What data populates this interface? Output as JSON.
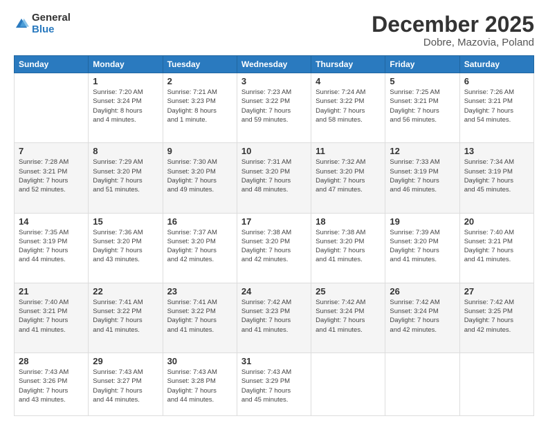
{
  "logo": {
    "general": "General",
    "blue": "Blue"
  },
  "title": "December 2025",
  "subtitle": "Dobre, Mazovia, Poland",
  "days_of_week": [
    "Sunday",
    "Monday",
    "Tuesday",
    "Wednesday",
    "Thursday",
    "Friday",
    "Saturday"
  ],
  "weeks": [
    [
      {
        "day": "",
        "info": ""
      },
      {
        "day": "1",
        "info": "Sunrise: 7:20 AM\nSunset: 3:24 PM\nDaylight: 8 hours\nand 4 minutes."
      },
      {
        "day": "2",
        "info": "Sunrise: 7:21 AM\nSunset: 3:23 PM\nDaylight: 8 hours\nand 1 minute."
      },
      {
        "day": "3",
        "info": "Sunrise: 7:23 AM\nSunset: 3:22 PM\nDaylight: 7 hours\nand 59 minutes."
      },
      {
        "day": "4",
        "info": "Sunrise: 7:24 AM\nSunset: 3:22 PM\nDaylight: 7 hours\nand 58 minutes."
      },
      {
        "day": "5",
        "info": "Sunrise: 7:25 AM\nSunset: 3:21 PM\nDaylight: 7 hours\nand 56 minutes."
      },
      {
        "day": "6",
        "info": "Sunrise: 7:26 AM\nSunset: 3:21 PM\nDaylight: 7 hours\nand 54 minutes."
      }
    ],
    [
      {
        "day": "7",
        "info": "Sunrise: 7:28 AM\nSunset: 3:21 PM\nDaylight: 7 hours\nand 52 minutes."
      },
      {
        "day": "8",
        "info": "Sunrise: 7:29 AM\nSunset: 3:20 PM\nDaylight: 7 hours\nand 51 minutes."
      },
      {
        "day": "9",
        "info": "Sunrise: 7:30 AM\nSunset: 3:20 PM\nDaylight: 7 hours\nand 49 minutes."
      },
      {
        "day": "10",
        "info": "Sunrise: 7:31 AM\nSunset: 3:20 PM\nDaylight: 7 hours\nand 48 minutes."
      },
      {
        "day": "11",
        "info": "Sunrise: 7:32 AM\nSunset: 3:20 PM\nDaylight: 7 hours\nand 47 minutes."
      },
      {
        "day": "12",
        "info": "Sunrise: 7:33 AM\nSunset: 3:19 PM\nDaylight: 7 hours\nand 46 minutes."
      },
      {
        "day": "13",
        "info": "Sunrise: 7:34 AM\nSunset: 3:19 PM\nDaylight: 7 hours\nand 45 minutes."
      }
    ],
    [
      {
        "day": "14",
        "info": "Sunrise: 7:35 AM\nSunset: 3:19 PM\nDaylight: 7 hours\nand 44 minutes."
      },
      {
        "day": "15",
        "info": "Sunrise: 7:36 AM\nSunset: 3:20 PM\nDaylight: 7 hours\nand 43 minutes."
      },
      {
        "day": "16",
        "info": "Sunrise: 7:37 AM\nSunset: 3:20 PM\nDaylight: 7 hours\nand 42 minutes."
      },
      {
        "day": "17",
        "info": "Sunrise: 7:38 AM\nSunset: 3:20 PM\nDaylight: 7 hours\nand 42 minutes."
      },
      {
        "day": "18",
        "info": "Sunrise: 7:38 AM\nSunset: 3:20 PM\nDaylight: 7 hours\nand 41 minutes."
      },
      {
        "day": "19",
        "info": "Sunrise: 7:39 AM\nSunset: 3:20 PM\nDaylight: 7 hours\nand 41 minutes."
      },
      {
        "day": "20",
        "info": "Sunrise: 7:40 AM\nSunset: 3:21 PM\nDaylight: 7 hours\nand 41 minutes."
      }
    ],
    [
      {
        "day": "21",
        "info": "Sunrise: 7:40 AM\nSunset: 3:21 PM\nDaylight: 7 hours\nand 41 minutes."
      },
      {
        "day": "22",
        "info": "Sunrise: 7:41 AM\nSunset: 3:22 PM\nDaylight: 7 hours\nand 41 minutes."
      },
      {
        "day": "23",
        "info": "Sunrise: 7:41 AM\nSunset: 3:22 PM\nDaylight: 7 hours\nand 41 minutes."
      },
      {
        "day": "24",
        "info": "Sunrise: 7:42 AM\nSunset: 3:23 PM\nDaylight: 7 hours\nand 41 minutes."
      },
      {
        "day": "25",
        "info": "Sunrise: 7:42 AM\nSunset: 3:24 PM\nDaylight: 7 hours\nand 41 minutes."
      },
      {
        "day": "26",
        "info": "Sunrise: 7:42 AM\nSunset: 3:24 PM\nDaylight: 7 hours\nand 42 minutes."
      },
      {
        "day": "27",
        "info": "Sunrise: 7:42 AM\nSunset: 3:25 PM\nDaylight: 7 hours\nand 42 minutes."
      }
    ],
    [
      {
        "day": "28",
        "info": "Sunrise: 7:43 AM\nSunset: 3:26 PM\nDaylight: 7 hours\nand 43 minutes."
      },
      {
        "day": "29",
        "info": "Sunrise: 7:43 AM\nSunset: 3:27 PM\nDaylight: 7 hours\nand 44 minutes."
      },
      {
        "day": "30",
        "info": "Sunrise: 7:43 AM\nSunset: 3:28 PM\nDaylight: 7 hours\nand 44 minutes."
      },
      {
        "day": "31",
        "info": "Sunrise: 7:43 AM\nSunset: 3:29 PM\nDaylight: 7 hours\nand 45 minutes."
      },
      {
        "day": "",
        "info": ""
      },
      {
        "day": "",
        "info": ""
      },
      {
        "day": "",
        "info": ""
      }
    ]
  ]
}
